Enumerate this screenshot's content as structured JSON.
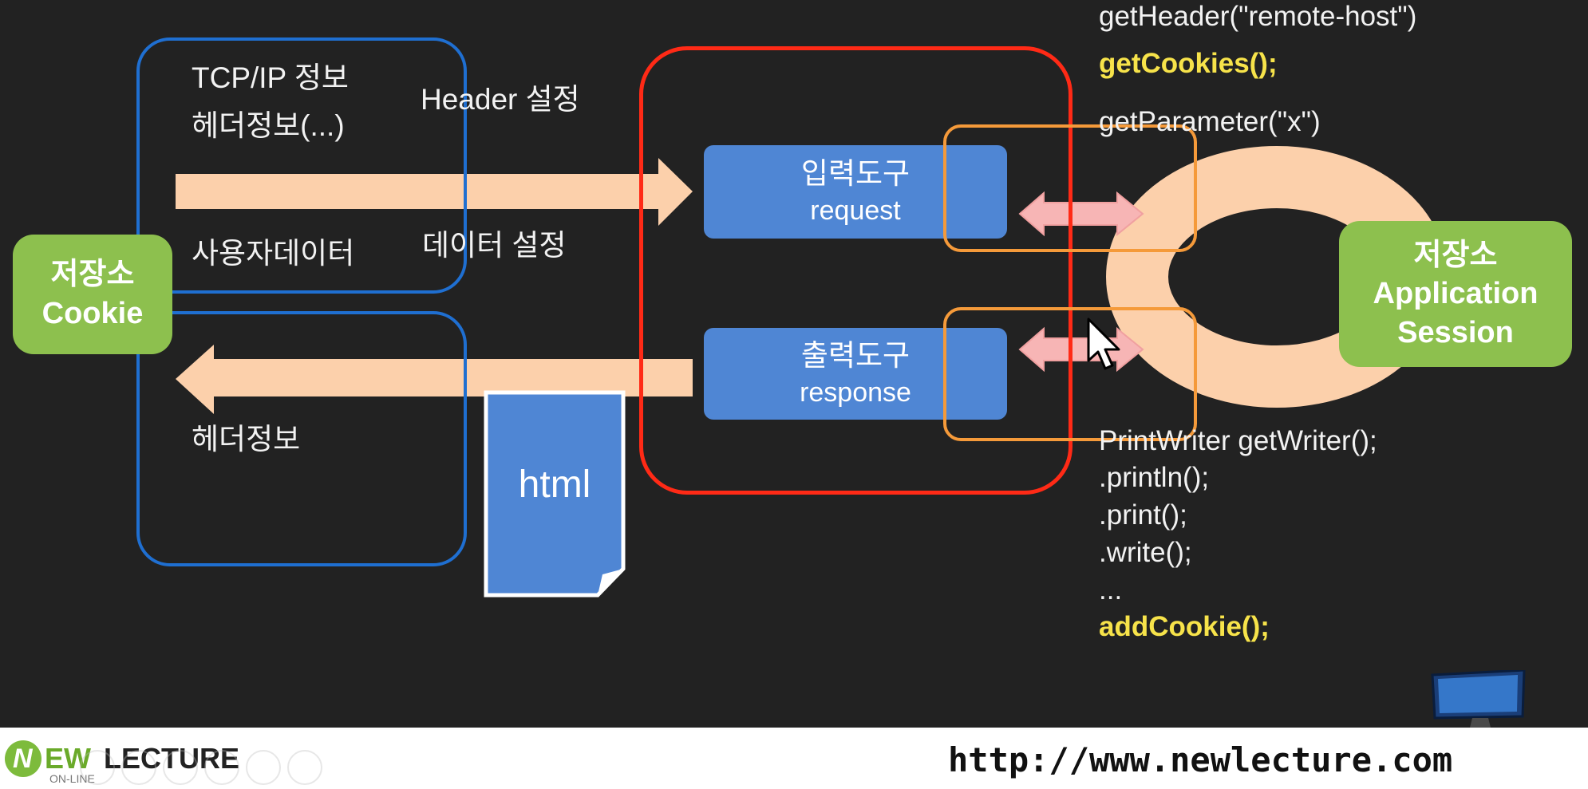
{
  "left_storage": {
    "title": "저장소",
    "subtitle": "Cookie"
  },
  "right_storage": {
    "title": "저장소",
    "line2": "Application",
    "line3": "Session"
  },
  "upper_panel": {
    "tcp_info": "TCP/IP 정보",
    "header_info": "헤더정보(...)",
    "user_data": "사용자데이터"
  },
  "lower_panel": {
    "header_info": "헤더정보"
  },
  "labels": {
    "header_setting": "Header 설정",
    "data_setting": "데이터 설정"
  },
  "input_tool": {
    "title": "입력도구",
    "name": "request"
  },
  "output_tool": {
    "title": "출력도구",
    "name": "response"
  },
  "html_doc": {
    "label": "html"
  },
  "request_methods": {
    "get_header": "getHeader(\"remote-host\")",
    "get_cookies": "getCookies();",
    "get_parameter": "getParameter(\"x\")"
  },
  "response_methods": {
    "get_writer": "PrintWriter getWriter();",
    "println": ".println();",
    "print": ".print();",
    "write": ".write();",
    "ellipsis": "...",
    "add_cookie": "addCookie();"
  },
  "footer": {
    "logo_n": "N",
    "logo_ew": "EW",
    "logo_lecture": "LECTURE",
    "logo_sub": "ON-LINE",
    "url": "http://www.newlecture.com"
  },
  "colors": {
    "background": "#222222",
    "green": "#8dc04e",
    "blue_box": "#4f86d4",
    "blue_outline": "#1f6fd1",
    "red_outline": "#ff2a16",
    "orange_outline": "#f59a3a",
    "peach": "#fcd0ab",
    "pink_arrow": "#f7b5b5",
    "highlight": "#f7e34a"
  }
}
